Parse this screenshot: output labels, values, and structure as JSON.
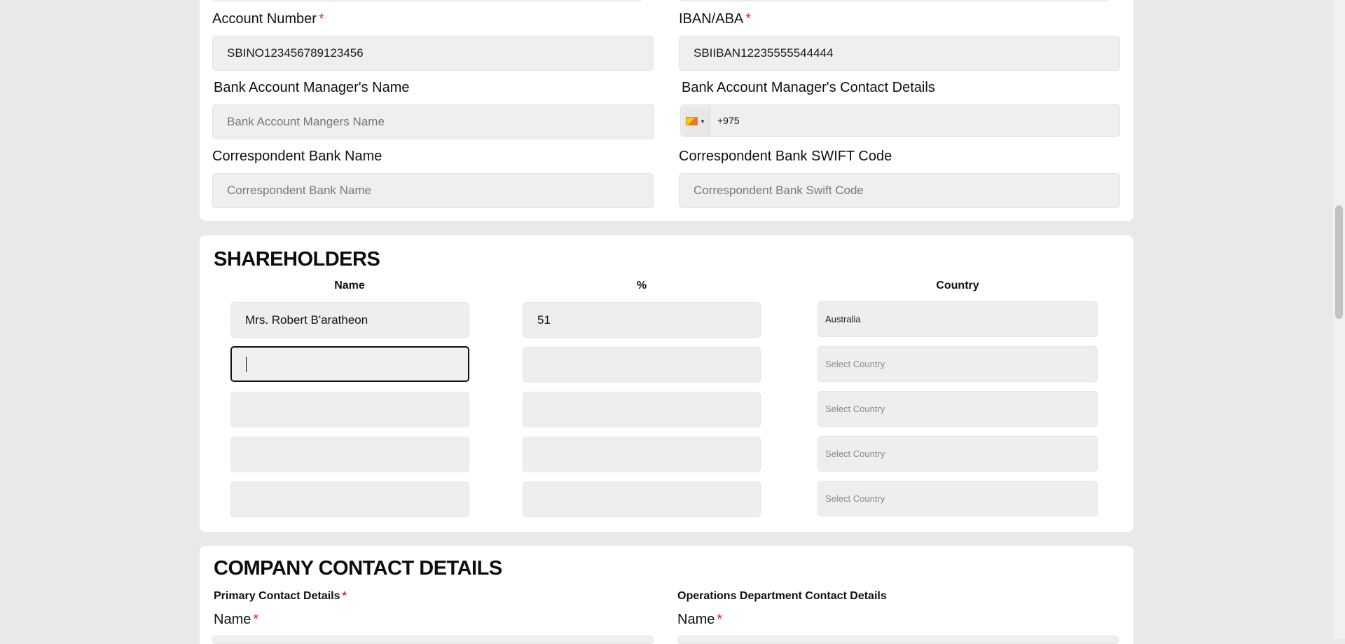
{
  "bank": {
    "account_number_label": "Account Number",
    "account_number_value": "SBINO123456789123456",
    "iban_label": "IBAN/ABA",
    "iban_value": "SBIIBAN12235555544444",
    "manager_name_label": "Bank Account Manager's Name",
    "manager_name_placeholder": "Bank Account Mangers Name",
    "manager_contact_label": "Bank Account Manager's Contact Details",
    "manager_contact_value": "+975",
    "correspondent_name_label": "Correspondent Bank Name",
    "correspondent_name_placeholder": "Correspondent Bank Name",
    "correspondent_swift_label": "Correspondent Bank SWIFT Code",
    "correspondent_swift_placeholder": "Correspondent Bank Swift Code",
    "required_mark": "*"
  },
  "shareholders": {
    "title": "SHAREHOLDERS",
    "col_name": "Name",
    "col_percent": "%",
    "col_country": "Country",
    "rows": [
      {
        "name": "Mrs. Robert B'aratheon",
        "percent": "51",
        "country": "Australia"
      },
      {
        "name": "",
        "percent": "",
        "country": "Select Country"
      },
      {
        "name": "",
        "percent": "",
        "country": "Select Country"
      },
      {
        "name": "",
        "percent": "",
        "country": "Select Country"
      },
      {
        "name": "",
        "percent": "",
        "country": "Select Country"
      }
    ]
  },
  "contact": {
    "title": "COMPANY CONTACT DETAILS",
    "primary_label": "Primary Contact Details",
    "operations_label": "Operations Department Contact Details",
    "name_label": "Name",
    "required_mark": "*"
  },
  "colors": {
    "required": "#e0262d",
    "input_bg": "#efefef",
    "page_bg": "#e9e9e9"
  },
  "icons": {
    "country_flag": "flag-icon",
    "dropdown": "caret-down-icon"
  }
}
